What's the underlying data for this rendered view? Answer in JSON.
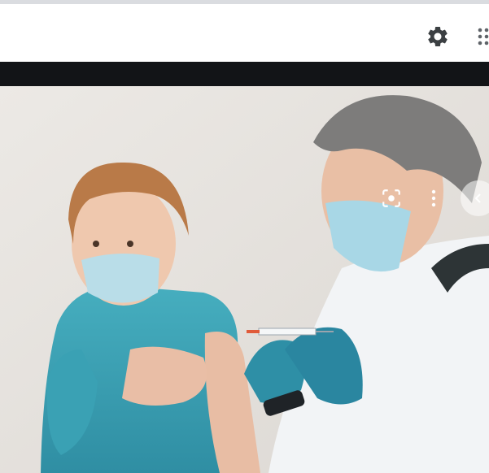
{
  "header": {
    "settings_icon": "gear-icon",
    "apps_icon": "apps-grid-icon"
  },
  "viewer": {
    "image_description_icons": [
      "lens-icon",
      "more-vert-icon",
      "chevron-left-icon"
    ],
    "colors": {
      "background": "#e9e6e2",
      "dark_bar": "#121417",
      "shirt": "#3fa3b7",
      "glove": "#2e8fa6",
      "coat": "#f2f4f6"
    }
  }
}
